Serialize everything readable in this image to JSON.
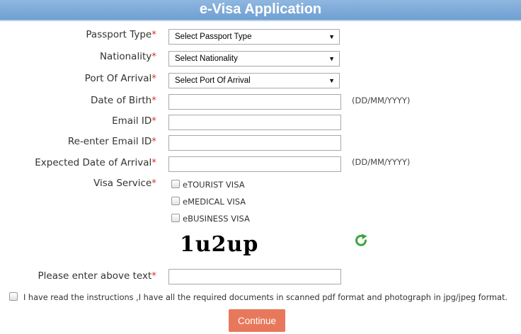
{
  "header": {
    "title": "e-Visa Application"
  },
  "required_mark": "*",
  "fields": {
    "passport_type": {
      "label": "Passport Type",
      "selected": "Select Passport Type"
    },
    "nationality": {
      "label": "Nationality",
      "selected": "Select Nationality"
    },
    "port_of_arrival": {
      "label": "Port Of Arrival",
      "selected": "Select Port Of Arrival"
    },
    "date_of_birth": {
      "label": "Date of Birth",
      "value": "",
      "hint": "(DD/MM/YYYY)"
    },
    "email": {
      "label": "Email ID",
      "value": ""
    },
    "reenter_email": {
      "label": "Re-enter Email ID",
      "value": ""
    },
    "expected_arrival": {
      "label": "Expected Date of Arrival",
      "value": "",
      "hint": "(DD/MM/YYYY)"
    },
    "visa_service": {
      "label": "Visa Service",
      "options": [
        "eTOURIST VISA",
        "eMEDICAL VISA",
        "eBUSINESS VISA"
      ]
    },
    "captcha": {
      "text": "1u2up",
      "input_label": "Please enter above text",
      "value": ""
    }
  },
  "terms": "I have read the instructions ,I have all the required documents in scanned pdf format and photograph in jpg/jpeg format.",
  "buttons": {
    "continue": "Continue"
  },
  "icons": {
    "refresh": "refresh-icon",
    "dropdown": "chevron-down-icon",
    "checkbox": "checkbox-icon"
  },
  "colors": {
    "header_bg": "#7aa7d8",
    "required": "#d9322a",
    "continue_bg": "#e8785b",
    "refresh": "#3aa640"
  }
}
